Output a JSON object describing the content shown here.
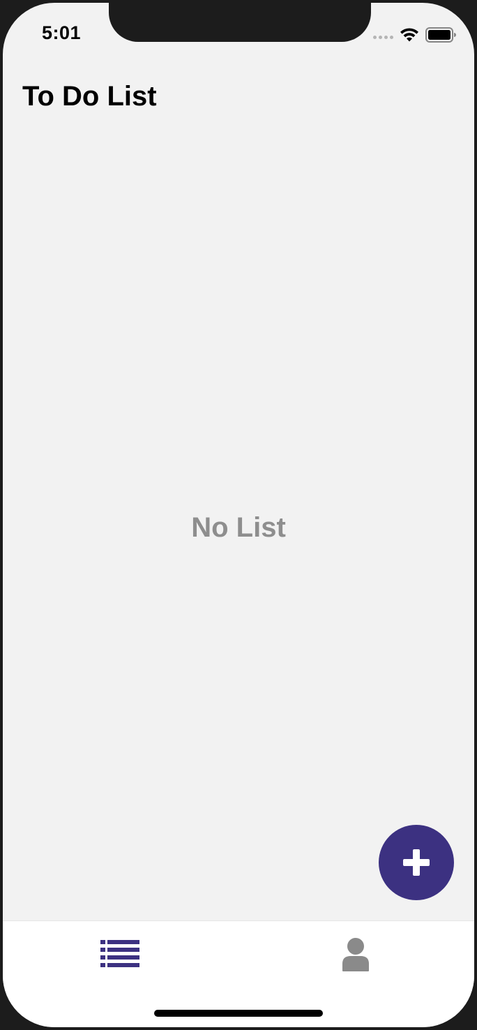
{
  "status_bar": {
    "time": "5:01",
    "icons": [
      "signal-dots-icon",
      "wifi-icon",
      "battery-icon"
    ]
  },
  "header": {
    "title": "To Do List"
  },
  "main": {
    "empty_message": "No List"
  },
  "fab": {
    "icon": "plus-icon",
    "color": "#3c3181"
  },
  "tab_bar": {
    "tabs": [
      {
        "icon": "list-icon",
        "active": true,
        "color": "#3c3181"
      },
      {
        "icon": "user-icon",
        "active": false,
        "color": "#8a8a8a"
      }
    ]
  }
}
